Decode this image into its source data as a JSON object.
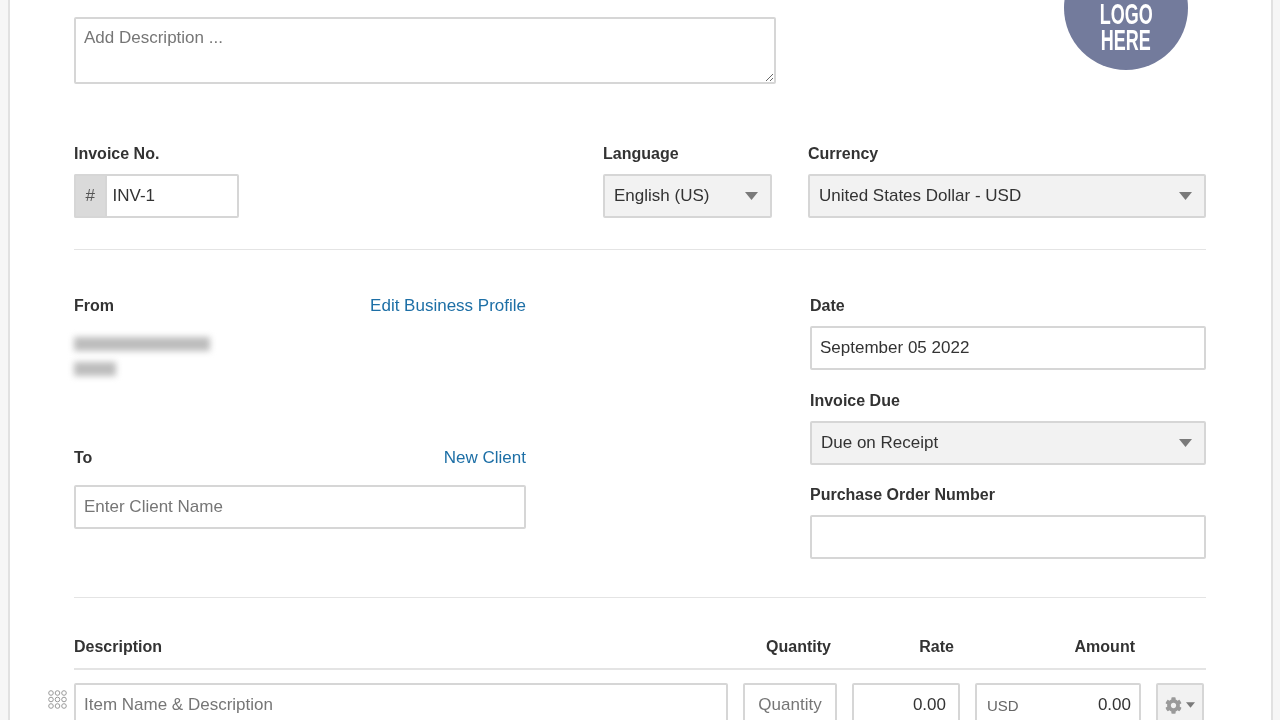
{
  "description": {
    "placeholder": "Add Description ..."
  },
  "logo": {
    "lines": [
      "LOGO",
      "HERE"
    ]
  },
  "invoice_number": {
    "label": "Invoice No.",
    "prefix": "#",
    "value": "INV-1"
  },
  "language": {
    "label": "Language",
    "value": "English (US)"
  },
  "currency": {
    "label": "Currency",
    "value": "United States Dollar - USD"
  },
  "from": {
    "label": "From",
    "link": "Edit Business Profile"
  },
  "to": {
    "label": "To",
    "link": "New Client",
    "placeholder": "Enter Client Name"
  },
  "date": {
    "label": "Date",
    "value": "September 05 2022"
  },
  "invoice_due": {
    "label": "Invoice Due",
    "value": "Due on Receipt"
  },
  "purchase_order": {
    "label": "Purchase Order Number"
  },
  "items_table": {
    "columns": [
      "Description",
      "Quantity",
      "Rate",
      "Amount"
    ],
    "rows": [
      {
        "description_placeholder": "Item Name & Description",
        "quantity_placeholder": "Quantity",
        "rate": "0.00",
        "currency": "USD",
        "amount": "0.00"
      }
    ]
  }
}
